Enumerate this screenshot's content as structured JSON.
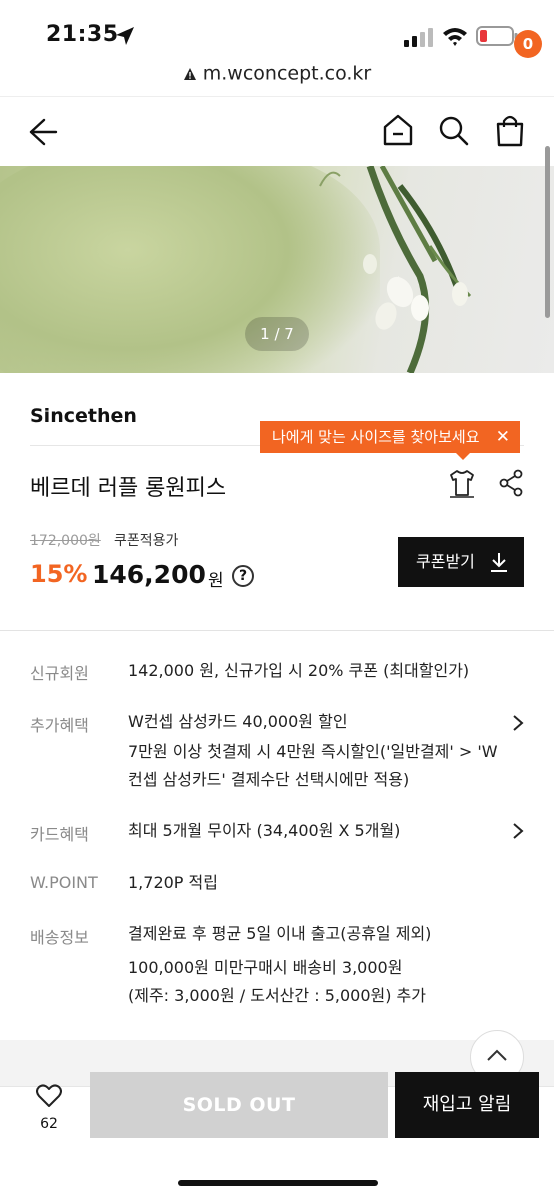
{
  "status": {
    "time": "21:35"
  },
  "browser": {
    "url": "m.wconcept.co.kr"
  },
  "header": {
    "cart_count": "0"
  },
  "gallery": {
    "pager": "1 / 7"
  },
  "product": {
    "brand": "Sincethen",
    "size_tooltip": "나에게 맞는 사이즈를 찾아보세요",
    "size_tooltip_close": "✕",
    "name": "베르데 러플 롱원피스",
    "original_price": "172,000원",
    "coupon_label": "쿠폰적용가",
    "discount": "15%",
    "price": "146,200",
    "currency": "원",
    "help": "?",
    "coupon_button": "쿠폰받기"
  },
  "benefits": [
    {
      "label": "신규회원",
      "lines": [
        "142,000 원, 신규가입 시 20% 쿠폰 (최대할인가)"
      ]
    },
    {
      "label": "추가혜택",
      "lines": [
        "W컨셉 삼성카드 40,000원 할인",
        "7만원 이상 첫결제 시 4만원 즉시할인('일반결제' > 'W",
        "컨셉 삼성카드' 결제수단 선택시에만 적용)"
      ]
    },
    {
      "label": "카드혜택",
      "lines": [
        "최대 5개월 무이자 (34,400원 X 5개월)"
      ]
    },
    {
      "label": "W.POINT",
      "lines": [
        "1,720P 적립"
      ]
    },
    {
      "label": "배송정보",
      "lines": [
        "결제완료 후 평균 5일 이내 출고(공휴일 제외)",
        "100,000원 미만구매시 배송비 3,000원",
        "(제주: 3,000원 / 도서산간 : 5,000원) 추가"
      ]
    }
  ],
  "bottom": {
    "like_count": "62",
    "sold_out": "SOLD OUT",
    "restock": "재입고 알림"
  },
  "colors": {
    "accent": "#f26522",
    "dark": "#111111",
    "disabled": "#d1d1d1"
  }
}
